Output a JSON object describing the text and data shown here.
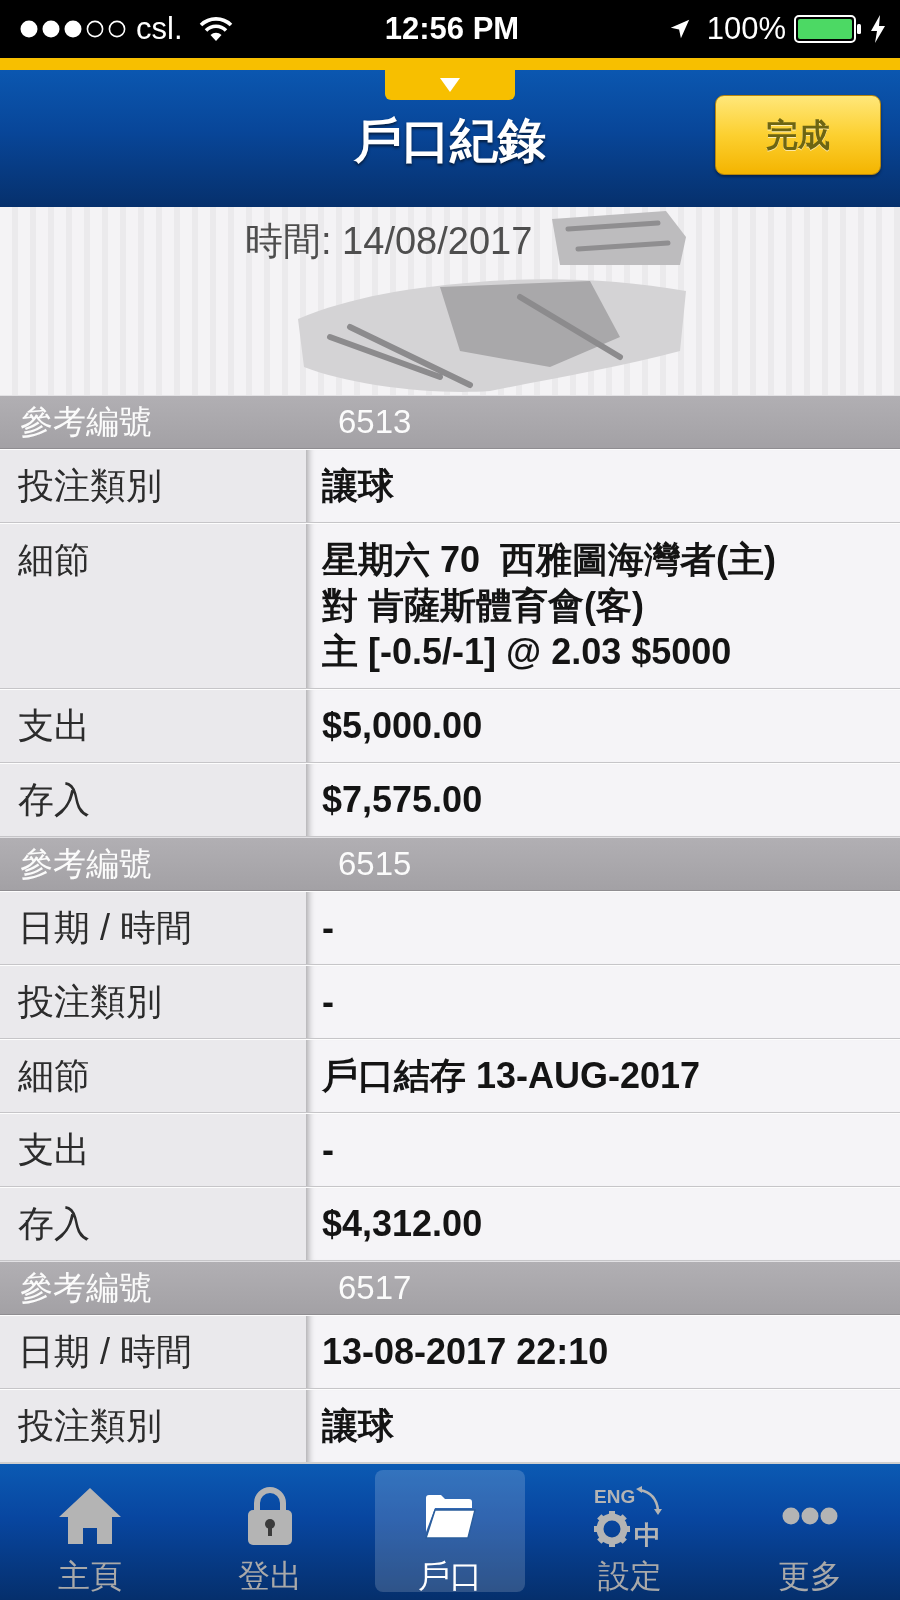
{
  "status_bar": {
    "carrier": "csl.",
    "time": "12:56 PM",
    "battery": "100%"
  },
  "header": {
    "title": "戶口紀錄",
    "done_button": "完成"
  },
  "receipt": {
    "time_line": "時間: 14/08/2017"
  },
  "records": [
    {
      "ref_label": "參考編號",
      "ref_number": "6513",
      "fields": [
        {
          "label": "投注類別",
          "value": "讓球"
        },
        {
          "label": "細節",
          "value": "星期六 70  西雅圖海灣者(主)\n對 肯薩斯體育會(客)\n主 [-0.5/-1] @ 2.03 $5000"
        },
        {
          "label": "支出",
          "value": "$5,000.00"
        },
        {
          "label": "存入",
          "value": "$7,575.00"
        }
      ]
    },
    {
      "ref_label": "參考編號",
      "ref_number": "6515",
      "fields": [
        {
          "label": "日期 / 時間",
          "value": "-"
        },
        {
          "label": "投注類別",
          "value": "-"
        },
        {
          "label": "細節",
          "value": "戶口結存 13-AUG-2017"
        },
        {
          "label": "支出",
          "value": "-"
        },
        {
          "label": "存入",
          "value": "$4,312.00"
        }
      ]
    },
    {
      "ref_label": "參考編號",
      "ref_number": "6517",
      "fields": [
        {
          "label": "日期 / 時間",
          "value": "13-08-2017 22:10"
        },
        {
          "label": "投注類別",
          "value": "讓球"
        }
      ]
    }
  ],
  "tabs": [
    {
      "label": "主頁",
      "selected": false
    },
    {
      "label": "登出",
      "selected": false
    },
    {
      "label": "戶口",
      "selected": true
    },
    {
      "label": "設定",
      "selected": false,
      "icon_text": [
        "ENG",
        "中"
      ]
    },
    {
      "label": "更多",
      "selected": false
    }
  ]
}
